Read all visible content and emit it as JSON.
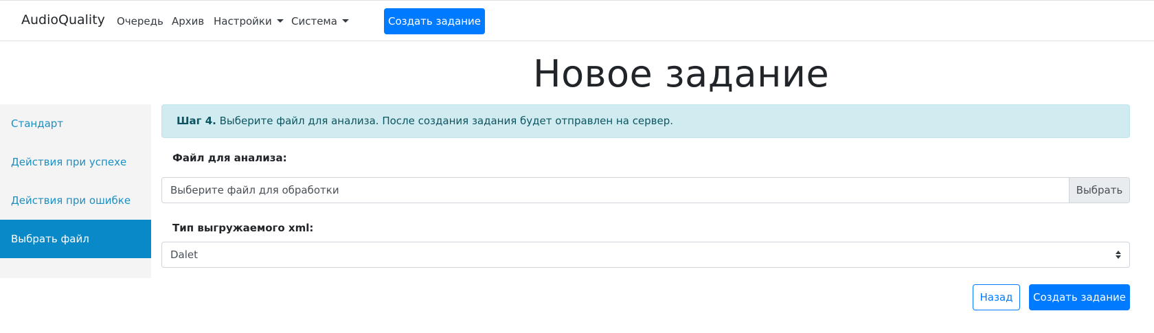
{
  "navbar": {
    "brand": "AudioQuality",
    "items": [
      {
        "label": "Очередь"
      },
      {
        "label": "Архив"
      },
      {
        "label": "Настройки"
      },
      {
        "label": "Система"
      }
    ],
    "create_button": "Создать задание"
  },
  "page": {
    "title": "Новое задание"
  },
  "sidebar": {
    "items": [
      {
        "label": "Стандарт"
      },
      {
        "label": "Действия при успехе"
      },
      {
        "label": "Действия при ошибке"
      },
      {
        "label": "Выбрать файл"
      }
    ],
    "active_index": 3
  },
  "alert": {
    "step": "Шаг 4.",
    "text": " Выберите файл для анализа. После создания задания будет отправлен на сервер."
  },
  "form": {
    "file_label": "Файл для анализа:",
    "file_placeholder": "Выберите файл для обработки",
    "file_button": "Выбрать",
    "xml_label": "Тип выгружаемого xml:",
    "xml_value": "Dalet"
  },
  "actions": {
    "back": "Назад",
    "create": "Создать задание"
  },
  "colors": {
    "primary": "#007bff",
    "sidebar_active": "#0a89c9",
    "sidebar_link": "#1b8fc4",
    "alert_bg": "#d1ecf1",
    "alert_text": "#0c5460"
  }
}
